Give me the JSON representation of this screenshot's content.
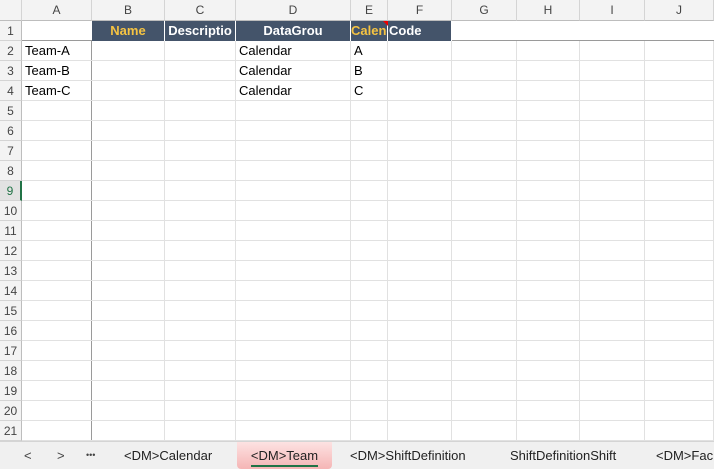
{
  "columns": [
    "A",
    "B",
    "C",
    "D",
    "E",
    "F",
    "G",
    "H",
    "I",
    "J"
  ],
  "rows": [
    "1",
    "2",
    "3",
    "4",
    "5",
    "6",
    "7",
    "8",
    "9",
    "10",
    "11",
    "12",
    "13",
    "14",
    "15",
    "16",
    "17",
    "18",
    "19",
    "20",
    "21"
  ],
  "selected_row": "9",
  "header": {
    "name": "Name",
    "description": "Descriptio",
    "datagroup": "DataGrou",
    "calendar": "Calendar",
    "code": "Code"
  },
  "data": [
    {
      "name": "Team-A",
      "calendar": "Calendar",
      "code": "A"
    },
    {
      "name": "Team-B",
      "calendar": "Calendar",
      "code": "B"
    },
    {
      "name": "Team-C",
      "calendar": "Calendar",
      "code": "C"
    }
  ],
  "tabs": {
    "prev": "<",
    "next": ">",
    "more": "•••",
    "items": [
      "<DM>Calendar",
      "<DM>Team",
      "<DM>ShiftDefinition",
      "ShiftDefinitionShift",
      "<DM>Fac"
    ],
    "active": "<DM>Team"
  },
  "colors": {
    "header_bg": "#44546a",
    "header_gold": "#f5c342",
    "active_tab": "#f8c9c9",
    "accent": "#217346"
  }
}
